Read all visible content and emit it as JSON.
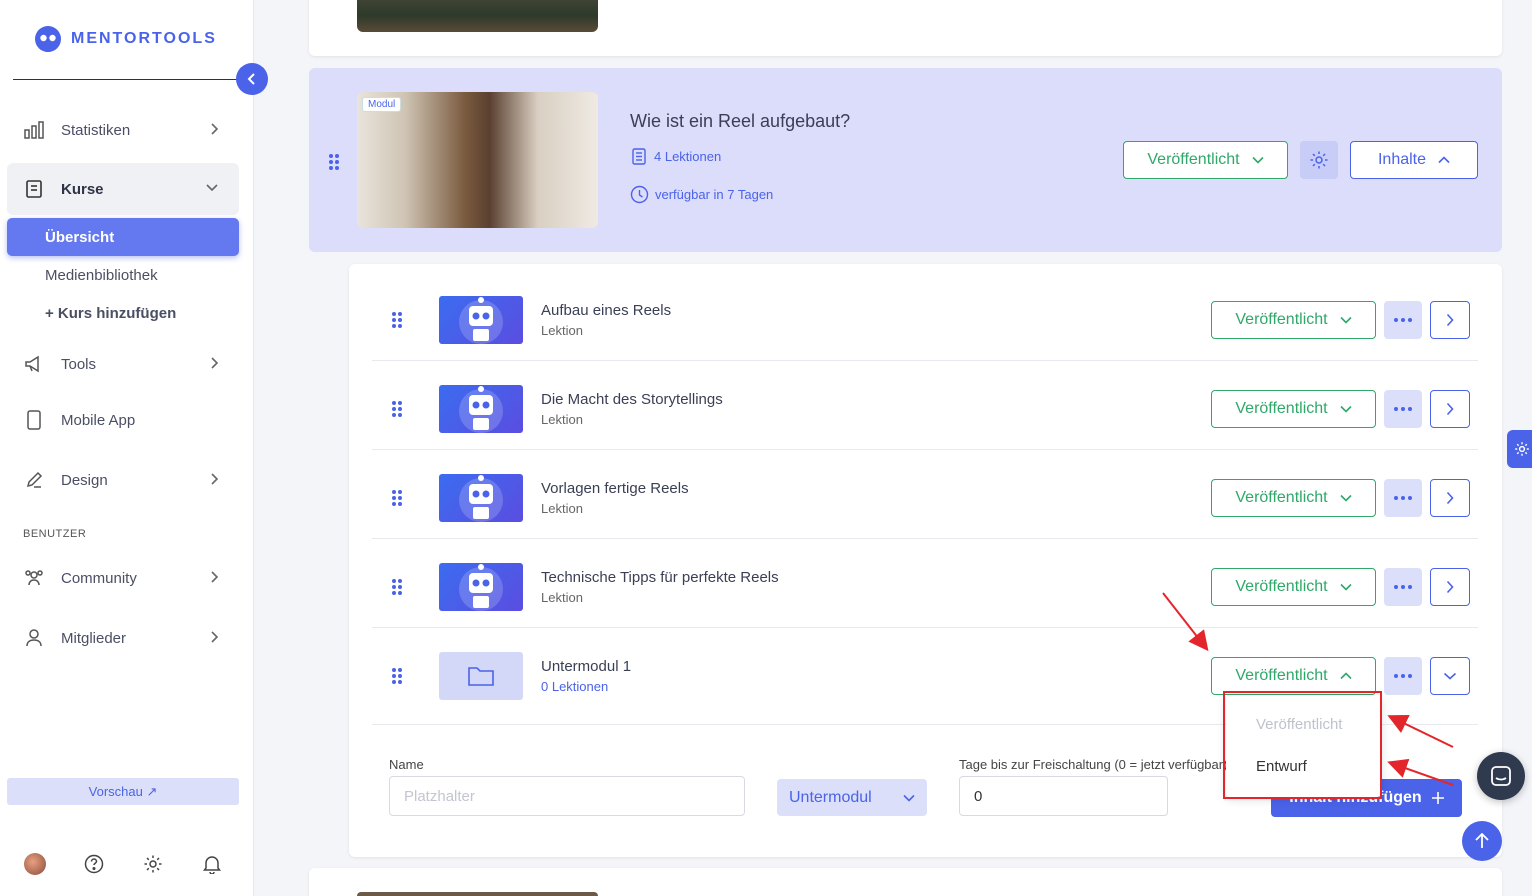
{
  "brand": {
    "name": "MENTORTOOLS"
  },
  "sidebar": {
    "items": [
      {
        "label": "Statistiken"
      },
      {
        "label": "Kurse"
      },
      {
        "label": "Tools"
      },
      {
        "label": "Mobile App"
      },
      {
        "label": "Design"
      },
      {
        "label": "Community"
      },
      {
        "label": "Mitglieder"
      }
    ],
    "kurse_sub": [
      {
        "label": "Übersicht"
      },
      {
        "label": "Medienbibliothek"
      },
      {
        "label": "+ Kurs hinzufügen"
      }
    ],
    "section_label": "BENUTZER",
    "preview_label": "Vorschau ↗"
  },
  "module": {
    "badge": "Modul",
    "title": "Wie ist ein Reel aufgebaut?",
    "lessons": "4 Lektionen",
    "availability": "verfügbar in 7 Tagen",
    "status": "Veröffentlicht",
    "contents_button": "Inhalte"
  },
  "lessons": [
    {
      "title": "Aufbau eines Reels",
      "type": "Lektion",
      "status": "Veröffentlicht"
    },
    {
      "title": "Die Macht des Storytellings",
      "type": "Lektion",
      "status": "Veröffentlicht"
    },
    {
      "title": "Vorlagen fertige Reels",
      "type": "Lektion",
      "status": "Veröffentlicht"
    },
    {
      "title": "Technische Tipps für perfekte Reels",
      "type": "Lektion",
      "status": "Veröffentlicht"
    }
  ],
  "submodule": {
    "title": "Untermodul 1",
    "lessons": "0 Lektionen",
    "status": "Veröffentlicht"
  },
  "status_dropdown": {
    "options": [
      "Veröffentlicht",
      "Entwurf"
    ]
  },
  "add_form": {
    "name_label": "Name",
    "name_placeholder": "Platzhalter",
    "type_value": "Untermodul",
    "days_label": "Tage bis zur Freischaltung (0 = jetzt verfügbar)",
    "days_value": "0",
    "submit_label": "Inhalt hinzufügen"
  },
  "colors": {
    "accent": "#4a63e8",
    "success": "#2fa86a",
    "annotation": "#e3262b"
  }
}
